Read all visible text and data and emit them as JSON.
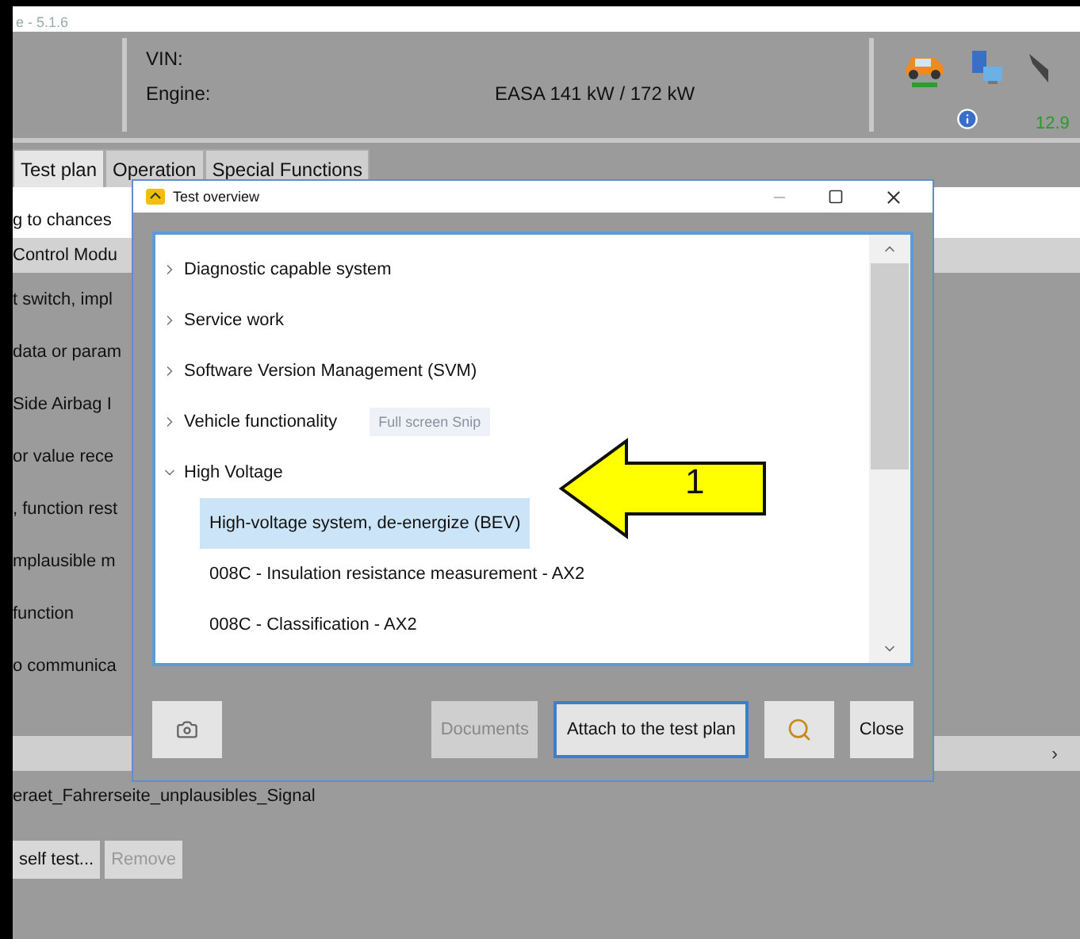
{
  "app": {
    "title": "e - 5.1.6",
    "vin_label": "VIN:",
    "engine_label": "Engine:",
    "engine_value": "EASA 141 kW / 172 kW",
    "voltage": "12.9",
    "tabs": [
      {
        "label": "Test plan",
        "selected": true
      },
      {
        "label": "Operation",
        "selected": false
      },
      {
        "label": "Special Functions",
        "selected": false
      }
    ],
    "rows": [
      {
        "text": "g to chances",
        "selected": true,
        "hover": false
      },
      {
        "text": "Control Modu",
        "selected": false,
        "hover": true
      },
      {
        "text": "t switch, impl",
        "selected": false,
        "hover": false
      },
      {
        "text": "data or param",
        "selected": false,
        "hover": false
      },
      {
        "text": "Side Airbag I",
        "selected": false,
        "hover": false
      },
      {
        "text": "or value rece",
        "selected": false,
        "hover": false
      },
      {
        "text": ", function rest",
        "selected": false,
        "hover": false
      },
      {
        "text": "mplausible m",
        "selected": false,
        "hover": false
      },
      {
        "text": "function",
        "selected": false,
        "hover": false
      },
      {
        "text": "o communica",
        "selected": false,
        "hover": false
      }
    ],
    "scroll_arrow": "›",
    "detail": "eraet_Fahrerseite_unplausibles_Signal",
    "buttons": [
      {
        "label": "self test...",
        "disabled": false
      },
      {
        "label": "Remove",
        "disabled": true
      }
    ]
  },
  "dialog": {
    "title": "Test overview",
    "tree": [
      {
        "label": "Diagnostic capable system",
        "expanded": false
      },
      {
        "label": "Service work",
        "expanded": false
      },
      {
        "label": "Software Version Management (SVM)",
        "expanded": false
      },
      {
        "label": "Vehicle functionality",
        "expanded": false
      },
      {
        "label": "High Voltage",
        "expanded": true,
        "children": [
          {
            "label": "High-voltage system, de-energize (BEV)",
            "selected": true
          },
          {
            "label": "008C  - Insulation resistance measurement - AX2",
            "selected": false
          },
          {
            "label": "008C  - Classification - AX2",
            "selected": false
          }
        ]
      }
    ],
    "tooltip": "Full screen Snip",
    "buttons": [
      {
        "label": "Documents",
        "disabled": true,
        "default": false
      },
      {
        "label": "Attach to the test plan",
        "disabled": false,
        "default": true
      }
    ],
    "close_button": "Close"
  },
  "callout": {
    "label": "1"
  }
}
